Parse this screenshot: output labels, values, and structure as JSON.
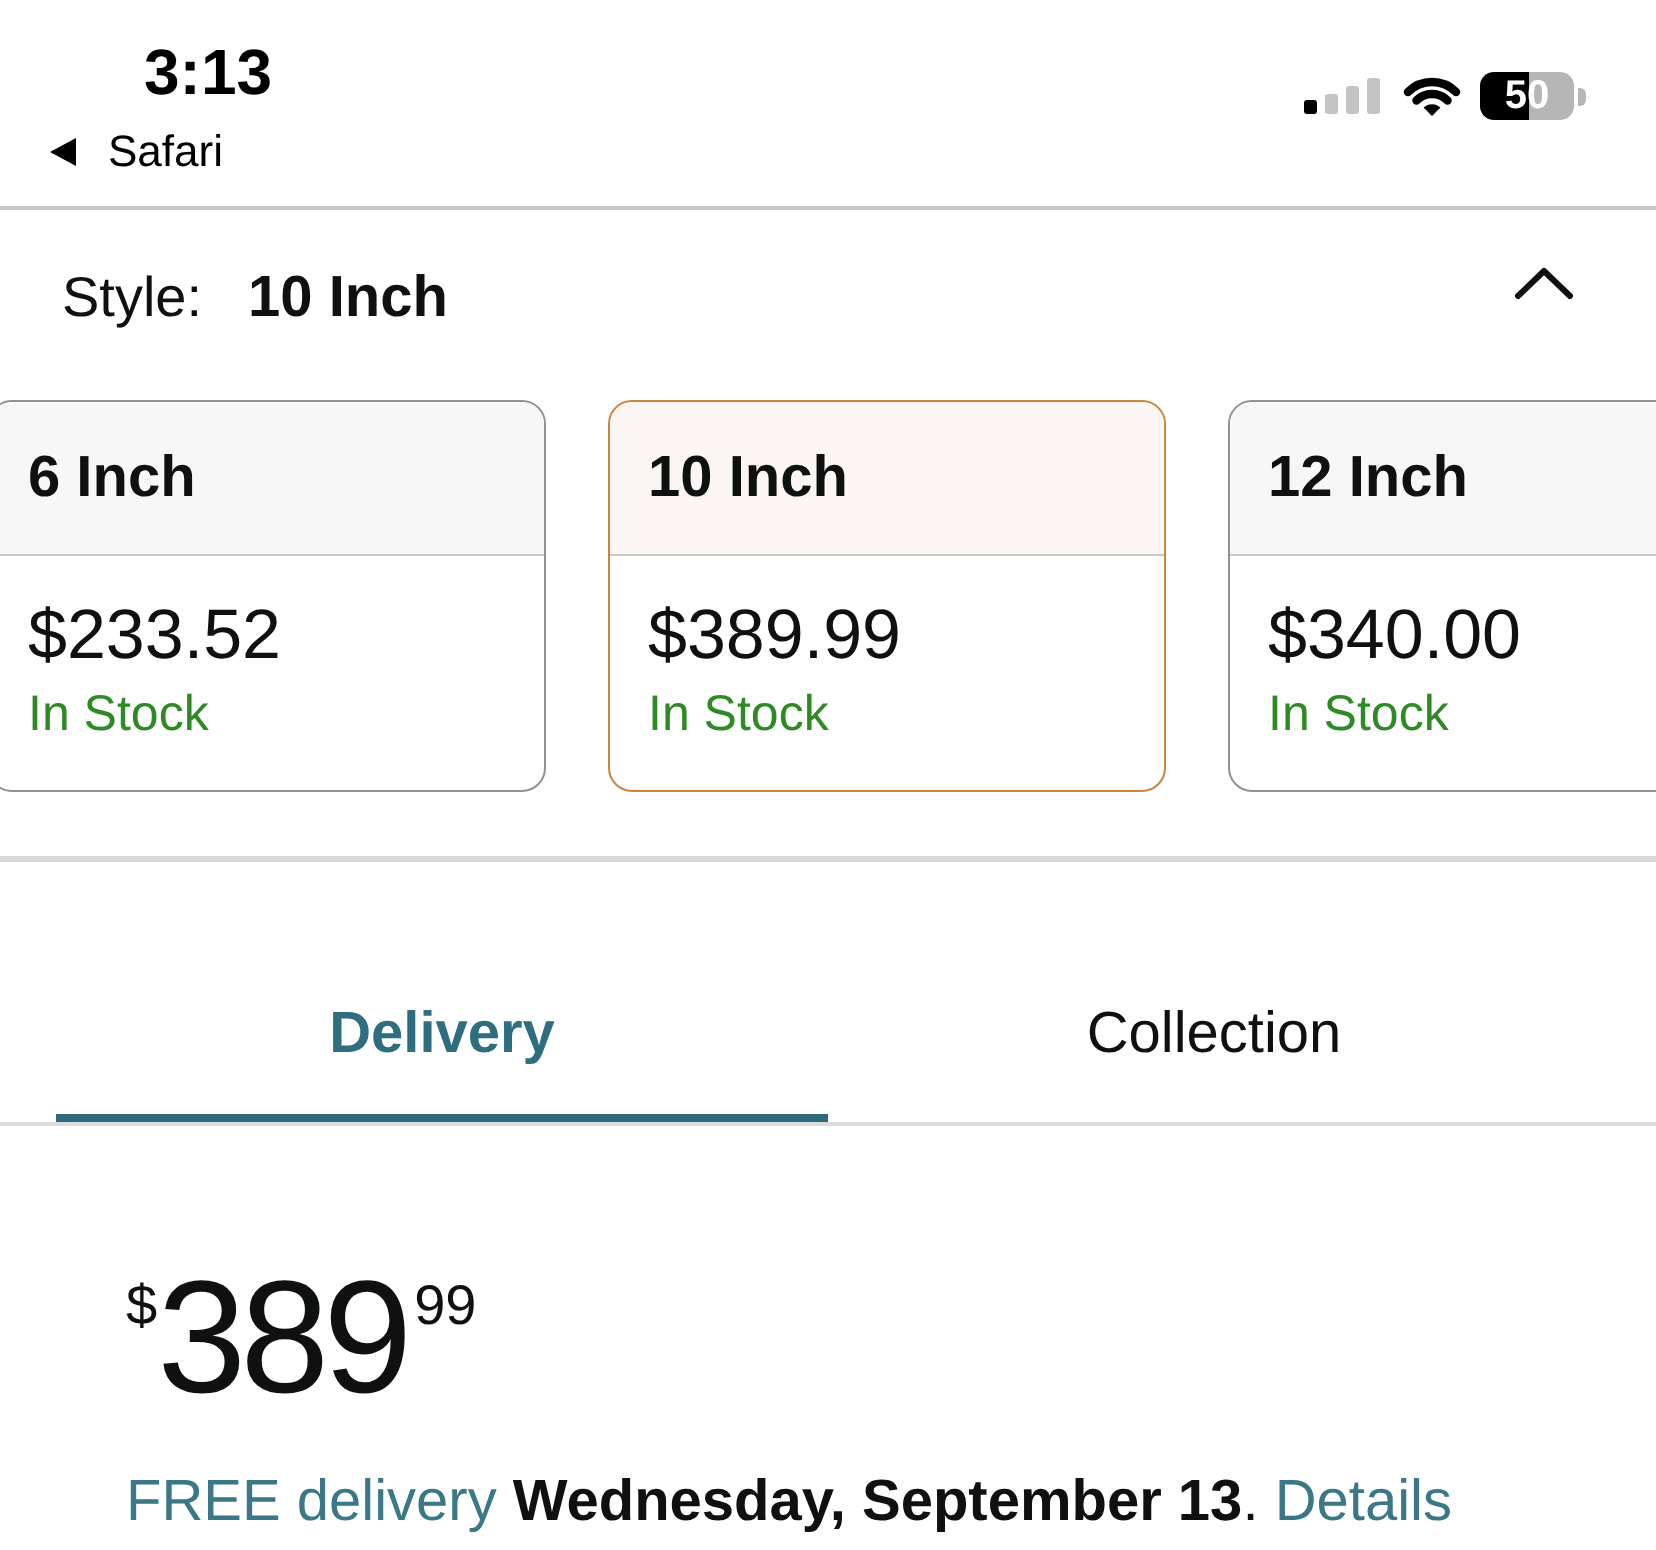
{
  "status_bar": {
    "time": "3:13",
    "back_label": "Safari",
    "battery": "50"
  },
  "style_selector": {
    "label": "Style:",
    "value": "10 Inch",
    "expanded": true
  },
  "options": [
    {
      "name": "6 Inch",
      "price": "$233.52",
      "availability": "In Stock",
      "selected": false
    },
    {
      "name": "10 Inch",
      "price": "$389.99",
      "availability": "In Stock",
      "selected": true
    },
    {
      "name": "12 Inch",
      "price": "$340.00",
      "availability": "In Stock",
      "selected": false
    }
  ],
  "tabs": [
    {
      "label": "Delivery",
      "selected": true
    },
    {
      "label": "Collection",
      "selected": false
    }
  ],
  "price": {
    "symbol": "$",
    "whole": "389",
    "fraction": "99"
  },
  "delivery": {
    "prefix": "FREE delivery",
    "date": "Wednesday, September 13",
    "suffix": ".",
    "link": "Details"
  }
}
